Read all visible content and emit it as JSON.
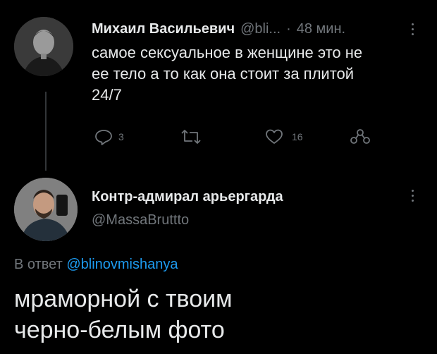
{
  "tweet": {
    "author_name": "Михаил Васильевич",
    "author_handle": "@bli...",
    "separator": "·",
    "time": "48 мин.",
    "text_lines": [
      "самое сексуальное в женщине это не",
      "ее тело а то как она стоит за плитой",
      "24/7"
    ],
    "actions": {
      "reply_count": "3",
      "retweet_count": "",
      "like_count": "16"
    }
  },
  "reply": {
    "author_name": "Контр-адмирал арьергарда",
    "author_handle": "@MassaBruttto",
    "reply_to_prefix": "В ответ",
    "reply_to_handle": "@blinovmishanya",
    "text_lines": [
      "мраморной с твоим",
      "черно-белым фото"
    ]
  },
  "colors": {
    "background": "#000000",
    "text": "#e7e9ea",
    "muted": "#71767b",
    "link": "#1d9bf0"
  }
}
